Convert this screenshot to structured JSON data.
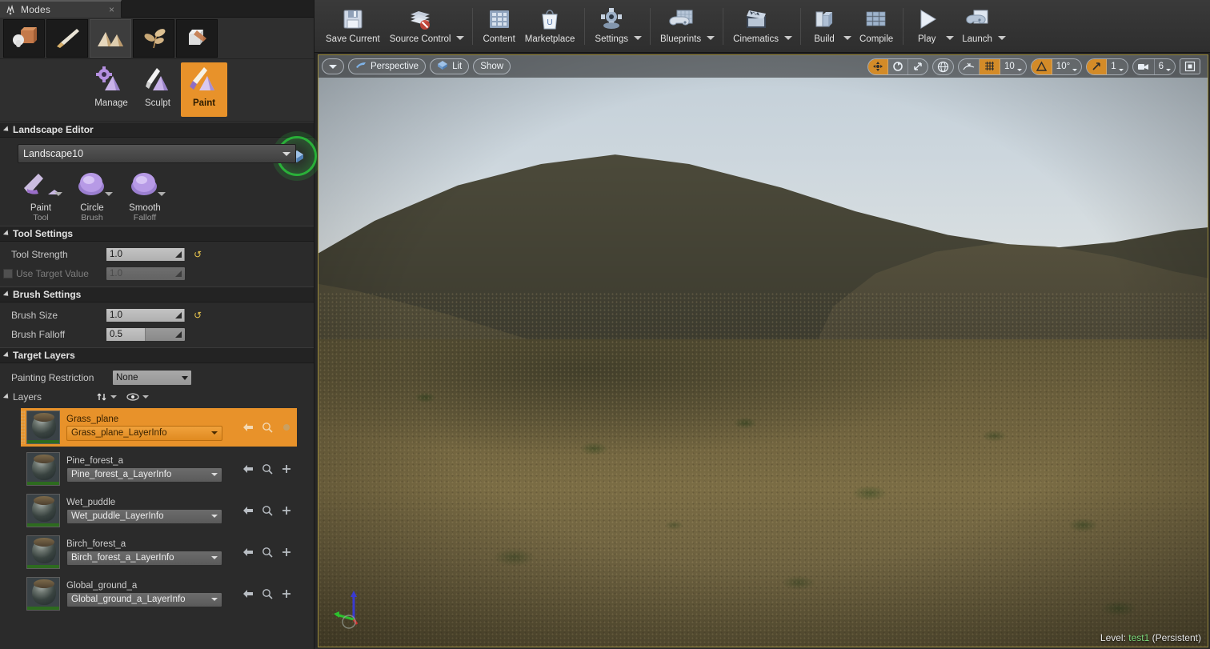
{
  "modes_panel": {
    "tab": {
      "label": "Modes",
      "icon": "modes-icon",
      "close": "×"
    },
    "mode_buttons": [
      {
        "name": "place-mode",
        "icon": "place-icon",
        "selected": false
      },
      {
        "name": "paint-mode",
        "icon": "paint-brush-icon",
        "selected": false
      },
      {
        "name": "landscape-mode",
        "icon": "landscape-icon",
        "selected": true
      },
      {
        "name": "foliage-mode",
        "icon": "foliage-icon",
        "selected": false
      },
      {
        "name": "geometry-editing-mode",
        "icon": "geometry-edit-icon",
        "selected": false
      }
    ],
    "subtools": [
      {
        "label": "Manage",
        "active": false
      },
      {
        "label": "Sculpt",
        "active": false
      },
      {
        "label": "Paint",
        "active": true
      }
    ]
  },
  "landscape_editor": {
    "section_title": "Landscape Editor",
    "target_selector": "Landscape10",
    "tools": [
      {
        "label": "Paint",
        "sub": "Tool"
      },
      {
        "label": "Circle",
        "sub": "Brush"
      },
      {
        "label": "Smooth",
        "sub": "Falloff"
      }
    ]
  },
  "tool_settings": {
    "section_title": "Tool Settings",
    "fields": [
      {
        "label": "Tool Strength",
        "value": "1.0",
        "disabled": false,
        "reset": "↺",
        "fill_pct": 100
      },
      {
        "label": "Use Target Value",
        "value": "1.0",
        "disabled": true,
        "reset": "",
        "fill_pct": 0
      }
    ]
  },
  "brush_settings": {
    "section_title": "Brush Settings",
    "fields": [
      {
        "label": "Brush Size",
        "value": "1.0",
        "disabled": false,
        "reset": "↺",
        "fill_pct": 100
      },
      {
        "label": "Brush Falloff",
        "value": "0.5",
        "disabled": false,
        "reset": "",
        "fill_pct": 50
      }
    ]
  },
  "target_layers": {
    "section_title": "Target Layers",
    "painting_restriction": {
      "label": "Painting Restriction",
      "value": "None"
    },
    "layers_label": "Layers",
    "layers": [
      {
        "name": "Grass_plane",
        "layerinfo": "Grass_plane_LayerInfo",
        "selected": true
      },
      {
        "name": "Pine_forest_a",
        "layerinfo": "Pine_forest_a_LayerInfo",
        "selected": false
      },
      {
        "name": "Wet_puddle",
        "layerinfo": "Wet_puddle_LayerInfo",
        "selected": false
      },
      {
        "name": "Birch_forest_a",
        "layerinfo": "Birch_forest_a_LayerInfo",
        "selected": false
      },
      {
        "name": "Global_ground_a",
        "layerinfo": "Global_ground_a_LayerInfo",
        "selected": false
      }
    ]
  },
  "toolbar": {
    "buttons": [
      {
        "label": "Save Current",
        "icon": "save-icon",
        "caret": false
      },
      {
        "label": "Source Control",
        "icon": "source-control-icon",
        "caret": true
      },
      {
        "label": "Content",
        "icon": "content-icon",
        "caret": false
      },
      {
        "label": "Marketplace",
        "icon": "marketplace-icon",
        "caret": false
      },
      {
        "label": "Settings",
        "icon": "settings-icon",
        "caret": true
      },
      {
        "label": "Blueprints",
        "icon": "blueprints-icon",
        "caret": true
      },
      {
        "label": "Cinematics",
        "icon": "cinematics-icon",
        "caret": true
      },
      {
        "label": "Build",
        "icon": "build-icon",
        "caret": true
      },
      {
        "label": "Compile",
        "icon": "compile-icon",
        "caret": false
      },
      {
        "label": "Play",
        "icon": "play-icon",
        "caret": true
      },
      {
        "label": "Launch",
        "icon": "launch-icon",
        "caret": true
      }
    ]
  },
  "viewport": {
    "view_menu": "",
    "perspective": "Perspective",
    "view_mode": "Lit",
    "show": "Show",
    "grid_snap_value": "10",
    "rotation_snap_value": "10°",
    "scale_snap_value": "1",
    "camera_speed_value": "6",
    "level_label": "Level:",
    "level_name": "test1",
    "level_state": "(Persistent)"
  },
  "colors": {
    "accent_orange": "#e8922a",
    "panel_bg": "#2b2b2b",
    "header_bg": "#232323",
    "viewport_border": "#9a8a3c",
    "level_green": "#7ddc7d",
    "click_halo_green": "#2ac83c"
  }
}
